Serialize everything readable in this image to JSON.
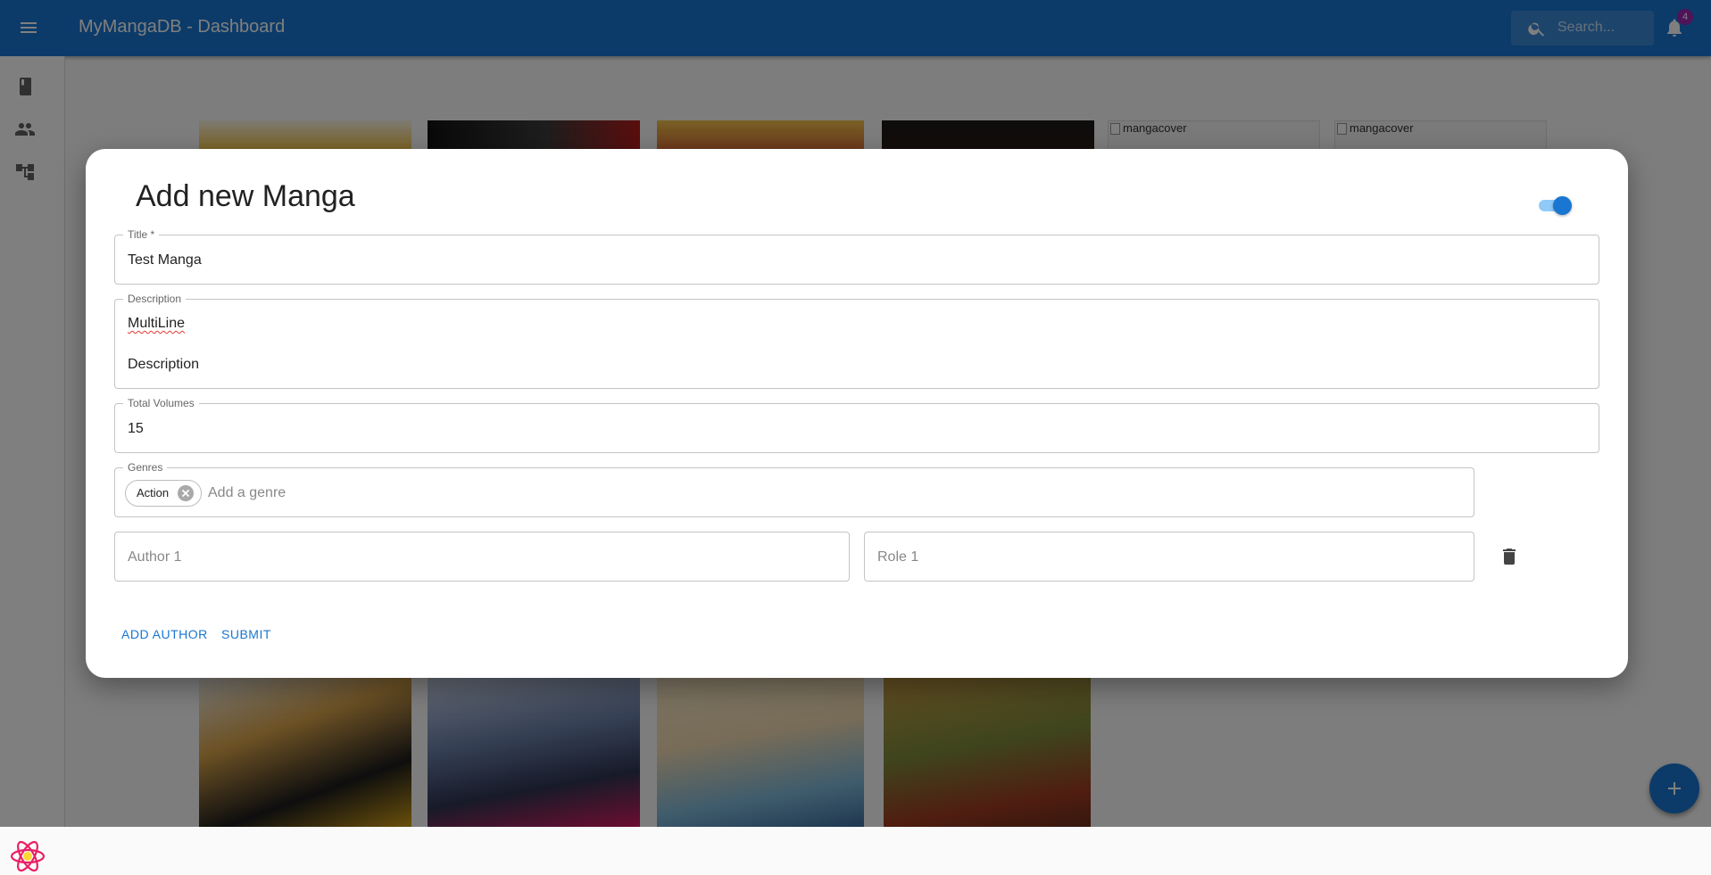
{
  "app": {
    "title": "MyMangaDB - Dashboard",
    "search_placeholder": "Search...",
    "notification_count": "4",
    "primary_color": "#1976d2"
  },
  "sidebar": {
    "items": [
      {
        "icon": "book-icon"
      },
      {
        "icon": "people-icon"
      },
      {
        "icon": "hierarchy-icon"
      }
    ]
  },
  "background_cards": {
    "broken_cover_alt": "mangacover"
  },
  "dialog": {
    "title": "Add new Manga",
    "toggle_on": true,
    "fields": {
      "title": {
        "label": "Title *",
        "value": "Test Manga"
      },
      "description": {
        "label": "Description",
        "line1": "MultiLine",
        "line2": "Description"
      },
      "total_volumes": {
        "label": "Total Volumes",
        "value": "15"
      },
      "genres": {
        "label": "Genres",
        "chips": [
          "Action"
        ],
        "placeholder": "Add a genre"
      },
      "author": {
        "placeholder": "Author 1"
      },
      "role": {
        "placeholder": "Role 1"
      }
    },
    "buttons": {
      "add_author": "ADD AUTHOR",
      "submit": "SUBMIT"
    }
  }
}
